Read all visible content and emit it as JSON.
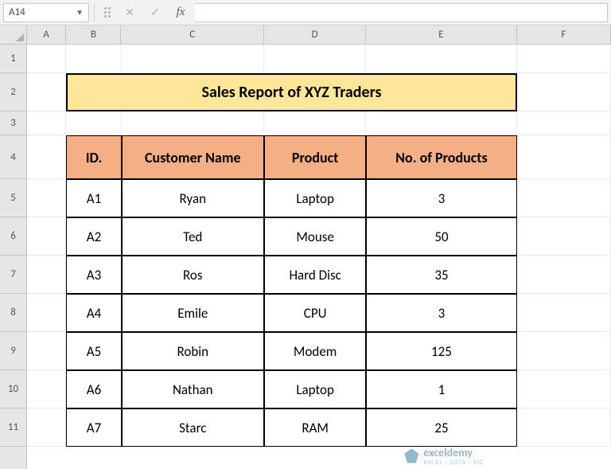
{
  "formula_bar": {
    "name_box": "A14",
    "cancel_glyph": "✕",
    "confirm_glyph": "✓",
    "fx_label": "fx",
    "formula_value": ""
  },
  "columns": [
    "A",
    "B",
    "C",
    "D",
    "E",
    "F"
  ],
  "row_numbers": [
    "1",
    "2",
    "3",
    "4",
    "5",
    "6",
    "7",
    "8",
    "9",
    "10",
    "11"
  ],
  "title": "Sales Report of XYZ Traders",
  "table": {
    "headers": {
      "id": "ID.",
      "customer": "Customer Name",
      "product": "Product",
      "qty": "No. of Products"
    },
    "rows": [
      {
        "id": "A1",
        "customer": "Ryan",
        "product": "Laptop",
        "qty": "3"
      },
      {
        "id": "A2",
        "customer": "Ted",
        "product": "Mouse",
        "qty": "50"
      },
      {
        "id": "A3",
        "customer": "Ros",
        "product": "Hard Disc",
        "qty": "35"
      },
      {
        "id": "A4",
        "customer": "Emile",
        "product": "CPU",
        "qty": "3"
      },
      {
        "id": "A5",
        "customer": "Robin",
        "product": "Modem",
        "qty": "125"
      },
      {
        "id": "A6",
        "customer": "Nathan",
        "product": "Laptop",
        "qty": "1"
      },
      {
        "id": "A7",
        "customer": "Starc",
        "product": "RAM",
        "qty": "25"
      }
    ]
  },
  "watermark": {
    "brand": "exceldemy",
    "tagline": "EXCEL · DATA · VIZ"
  }
}
